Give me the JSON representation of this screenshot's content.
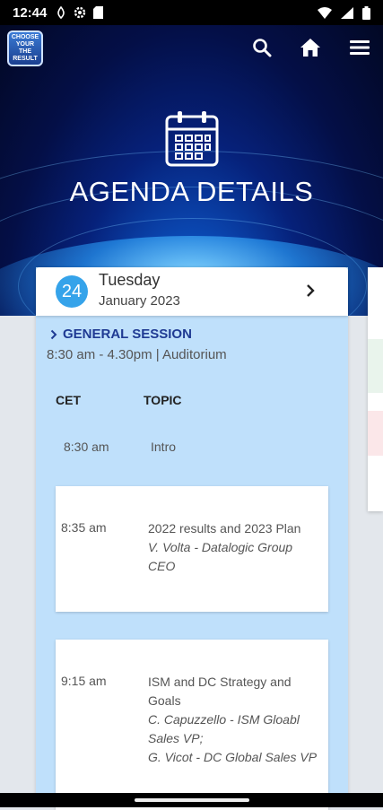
{
  "status": {
    "time": "12:44"
  },
  "header": {
    "logo_text": "CHOOSE YOUR THE RESULT",
    "title": "AGENDA DETAILS"
  },
  "date": {
    "day": "24",
    "weekday": "Tuesday",
    "month_year": "January 2023"
  },
  "session": {
    "title": "GENERAL SESSION",
    "subtitle": "8:30 am - 4.30pm | Auditorium"
  },
  "columns": {
    "time": "CET",
    "topic": "TOPIC"
  },
  "items": [
    {
      "time": "8:30 am",
      "topic": "Intro"
    },
    {
      "time": "8:35 am",
      "topic": "2022 results and 2023 Plan",
      "speakers": [
        "V. Volta - Datalogic Group CEO"
      ]
    },
    {
      "time": "9:15 am",
      "topic": "ISM and DC Strategy and Goals",
      "speakers": [
        "C. Capuzzello - ISM Gloabl Sales VP;",
        "G. Vicot - DC Global Sales VP"
      ]
    }
  ],
  "icons": [
    "wifi-icon",
    "signal-icon",
    "battery-icon",
    "search-icon",
    "home-icon",
    "menu-icon",
    "calendar-icon",
    "chevron-right-icon"
  ],
  "colors": {
    "accent": "#35a3ea",
    "session_title": "#1f3a93",
    "column_bg": "#bfe0fb"
  }
}
